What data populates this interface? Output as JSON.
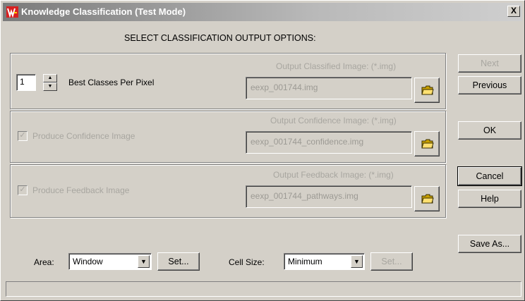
{
  "window": {
    "title": "Knowledge Classification (Test Mode)",
    "close_label": "X"
  },
  "heading": "SELECT CLASSIFICATION OUTPUT OPTIONS:",
  "classes": {
    "count_value": "1",
    "label": "Best Classes Per Pixel"
  },
  "outputs": {
    "classified": {
      "label": "Output Classified Image: (*.img)",
      "value": "eexp_001744.img"
    },
    "confidence": {
      "checkbox_label": "Produce Confidence Image",
      "checked": true,
      "label": "Output Confidence Image: (*.img)",
      "value": "eexp_001744_confidence.img"
    },
    "feedback": {
      "checkbox_label": "Produce Feedback Image",
      "checked": true,
      "label": "Output Feedback Image: (*.img)",
      "value": "eexp_001744_pathways.img"
    }
  },
  "bottom": {
    "area_label": "Area:",
    "area_value": "Window",
    "set_label": "Set...",
    "cell_size_label": "Cell Size:",
    "cell_size_value": "Minimum",
    "set2_label": "Set..."
  },
  "buttons": {
    "next": "Next",
    "previous": "Previous",
    "ok": "OK",
    "cancel": "Cancel",
    "help": "Help",
    "save_as": "Save As..."
  },
  "status_text": "",
  "icons": {
    "app": "app-logo-icon",
    "folder": "open-folder-icon"
  }
}
